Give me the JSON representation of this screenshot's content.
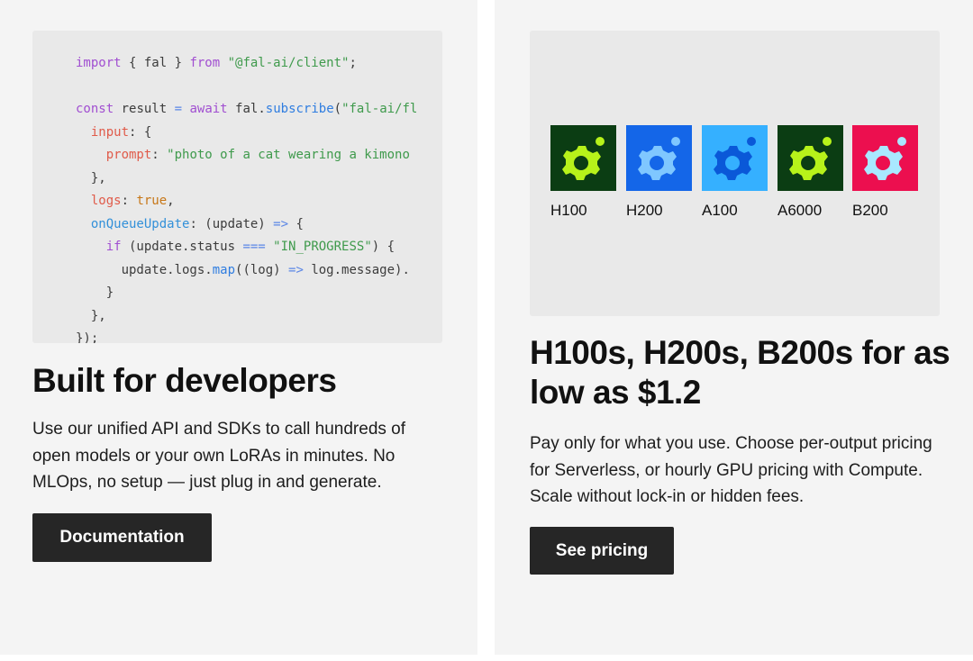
{
  "left_card": {
    "code_lines": [
      [
        {
          "t": "import",
          "c": "kw"
        },
        {
          "t": " { fal } ",
          "c": "plain"
        },
        {
          "t": "from",
          "c": "kw"
        },
        {
          "t": " ",
          "c": "plain"
        },
        {
          "t": "\"@fal-ai/client\"",
          "c": "str"
        },
        {
          "t": ";",
          "c": "plain"
        }
      ],
      [],
      [
        {
          "t": "const",
          "c": "kw"
        },
        {
          "t": " result ",
          "c": "plain"
        },
        {
          "t": "=",
          "c": "op"
        },
        {
          "t": " ",
          "c": "plain"
        },
        {
          "t": "await",
          "c": "kw"
        },
        {
          "t": " fal.",
          "c": "plain"
        },
        {
          "t": "subscribe",
          "c": "fn"
        },
        {
          "t": "(",
          "c": "plain"
        },
        {
          "t": "\"fal-ai/fl",
          "c": "str"
        }
      ],
      [
        {
          "t": "  ",
          "c": "plain"
        },
        {
          "t": "input",
          "c": "prop"
        },
        {
          "t": ": {",
          "c": "plain"
        }
      ],
      [
        {
          "t": "    ",
          "c": "plain"
        },
        {
          "t": "prompt",
          "c": "prop"
        },
        {
          "t": ": ",
          "c": "plain"
        },
        {
          "t": "\"photo of a cat wearing a kimono",
          "c": "str"
        }
      ],
      [
        {
          "t": "  },",
          "c": "plain"
        }
      ],
      [
        {
          "t": "  ",
          "c": "plain"
        },
        {
          "t": "logs",
          "c": "prop"
        },
        {
          "t": ": ",
          "c": "plain"
        },
        {
          "t": "true",
          "c": "bool"
        },
        {
          "t": ",",
          "c": "plain"
        }
      ],
      [
        {
          "t": "  ",
          "c": "plain"
        },
        {
          "t": "onQueueUpdate",
          "c": "prop2"
        },
        {
          "t": ": (update) ",
          "c": "plain"
        },
        {
          "t": "=>",
          "c": "op"
        },
        {
          "t": " {",
          "c": "plain"
        }
      ],
      [
        {
          "t": "    ",
          "c": "plain"
        },
        {
          "t": "if",
          "c": "kw"
        },
        {
          "t": " (update.status ",
          "c": "plain"
        },
        {
          "t": "===",
          "c": "op"
        },
        {
          "t": " ",
          "c": "plain"
        },
        {
          "t": "\"IN_PROGRESS\"",
          "c": "str"
        },
        {
          "t": ") {",
          "c": "plain"
        }
      ],
      [
        {
          "t": "      update.logs.",
          "c": "plain"
        },
        {
          "t": "map",
          "c": "fn"
        },
        {
          "t": "((log) ",
          "c": "plain"
        },
        {
          "t": "=>",
          "c": "op"
        },
        {
          "t": " log.message).",
          "c": "plain"
        }
      ],
      [
        {
          "t": "    }",
          "c": "plain"
        }
      ],
      [
        {
          "t": "  },",
          "c": "plain"
        }
      ],
      [
        {
          "t": "});",
          "c": "plain"
        }
      ]
    ],
    "heading": "Built for developers",
    "body": "Use our unified API and SDKs to call hundreds of open models or your own LoRAs in minutes. No MLOps, no setup — just plug in and generate.",
    "button_label": "Documentation"
  },
  "right_card": {
    "gpus": [
      {
        "label": "H100",
        "bg": "#0b3d13",
        "fg": "#b7f21a"
      },
      {
        "label": "H200",
        "bg": "#1466e8",
        "fg": "#7fc7ff"
      },
      {
        "label": "A100",
        "bg": "#35b0ff",
        "fg": "#0a58d8"
      },
      {
        "label": "A6000",
        "bg": "#0b3d13",
        "fg": "#b7f21a"
      },
      {
        "label": "B200",
        "bg": "#ec0f4f",
        "fg": "#a9e8ff"
      }
    ],
    "heading": "H100s, H200s, B200s for as low as $1.2",
    "body": "Pay only for what you use. Choose per-output pricing for Serverless, or hourly GPU pricing with Compute. Scale without lock-in or hidden fees.",
    "button_label": "See pricing"
  },
  "colors": {
    "card_bg": "#f4f4f4",
    "panel_bg": "#e9e9e9",
    "button_bg": "#262626"
  },
  "icons": {
    "gpu_tile": "chip-gear-icon"
  }
}
